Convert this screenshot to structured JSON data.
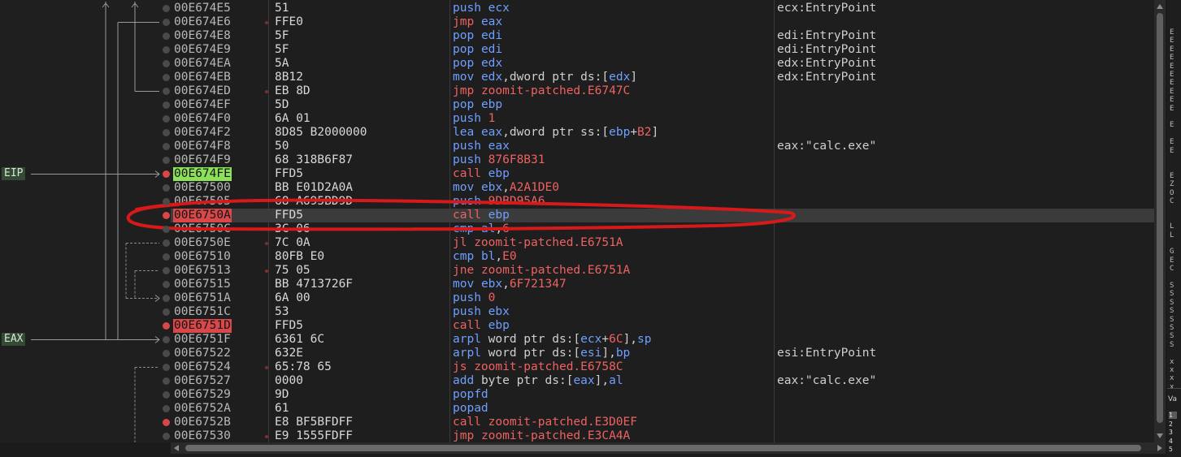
{
  "side_labels": [
    {
      "text": "EIP",
      "row": 12
    },
    {
      "text": "EAX",
      "row": 24
    }
  ],
  "rows": [
    {
      "addr": "00E674E5",
      "bytes": "51",
      "mnem": "push",
      "ops": "ecx",
      "comment": "ecx:EntryPoint",
      "marker": "grey",
      "jump": false
    },
    {
      "addr": "00E674E6",
      "bytes": "FFE0",
      "mnem": "jmp",
      "ops": "eax",
      "comment": "",
      "marker": "grey",
      "jump": true
    },
    {
      "addr": "00E674E8",
      "bytes": "5F",
      "mnem": "pop",
      "ops": "edi",
      "comment": "edi:EntryPoint",
      "marker": "grey",
      "jump": false
    },
    {
      "addr": "00E674E9",
      "bytes": "5F",
      "mnem": "pop",
      "ops": "edi",
      "comment": "edi:EntryPoint",
      "marker": "grey",
      "jump": false
    },
    {
      "addr": "00E674EA",
      "bytes": "5A",
      "mnem": "pop",
      "ops": "edx",
      "comment": "edx:EntryPoint",
      "marker": "grey",
      "jump": false
    },
    {
      "addr": "00E674EB",
      "bytes": "8B12",
      "mnem": "mov",
      "ops": "edx,dword ptr ds:[edx]",
      "comment": "edx:EntryPoint",
      "marker": "grey",
      "jump": false
    },
    {
      "addr": "00E674ED",
      "bytes": "EB 8D",
      "mnem": "jmp",
      "ops": "zoomit-patched.E6747C",
      "comment": "",
      "marker": "grey",
      "jump": true
    },
    {
      "addr": "00E674EF",
      "bytes": "5D",
      "mnem": "pop",
      "ops": "ebp",
      "comment": "",
      "marker": "grey",
      "jump": false
    },
    {
      "addr": "00E674F0",
      "bytes": "6A 01",
      "mnem": "push",
      "ops": "1",
      "comment": "",
      "marker": "grey",
      "jump": false
    },
    {
      "addr": "00E674F2",
      "bytes": "8D85 B2000000",
      "mnem": "lea",
      "ops": "eax,dword ptr ss:[ebp+B2]",
      "comment": "",
      "marker": "grey",
      "jump": false
    },
    {
      "addr": "00E674F8",
      "bytes": "50",
      "mnem": "push",
      "ops": "eax",
      "comment": "eax:\"calc.exe\"",
      "marker": "grey",
      "jump": false
    },
    {
      "addr": "00E674F9",
      "bytes": "68 318B6F87",
      "mnem": "push",
      "ops": "876F8B31",
      "comment": "",
      "marker": "grey",
      "jump": false
    },
    {
      "addr": "00E674FE",
      "bytes": "FFD5",
      "mnem": "call",
      "ops": "ebp",
      "comment": "",
      "marker": "red",
      "jump": false,
      "state": "eip"
    },
    {
      "addr": "00E67500",
      "bytes": "BB E01D2A0A",
      "mnem": "mov",
      "ops": "ebx,A2A1DE0",
      "comment": "",
      "marker": "grey",
      "jump": false
    },
    {
      "addr": "00E67505",
      "bytes": "68 A695BD9D",
      "mnem": "push",
      "ops": "9DBD95A6",
      "comment": "",
      "marker": "grey",
      "jump": false
    },
    {
      "addr": "00E6750A",
      "bytes": "FFD5",
      "mnem": "call",
      "ops": "ebp",
      "comment": "",
      "marker": "red",
      "jump": false,
      "state": "bp",
      "selected": true
    },
    {
      "addr": "00E6750C",
      "bytes": "3C 06",
      "mnem": "cmp",
      "ops": "al,6",
      "comment": "",
      "marker": "grey",
      "jump": false
    },
    {
      "addr": "00E6750E",
      "bytes": "7C 0A",
      "mnem": "jl",
      "ops": "zoomit-patched.E6751A",
      "comment": "",
      "marker": "grey",
      "jump": true
    },
    {
      "addr": "00E67510",
      "bytes": "80FB E0",
      "mnem": "cmp",
      "ops": "bl,E0",
      "comment": "",
      "marker": "grey",
      "jump": false
    },
    {
      "addr": "00E67513",
      "bytes": "75 05",
      "mnem": "jne",
      "ops": "zoomit-patched.E6751A",
      "comment": "",
      "marker": "grey",
      "jump": true
    },
    {
      "addr": "00E67515",
      "bytes": "BB 4713726F",
      "mnem": "mov",
      "ops": "ebx,6F721347",
      "comment": "",
      "marker": "grey",
      "jump": false
    },
    {
      "addr": "00E6751A",
      "bytes": "6A 00",
      "mnem": "push",
      "ops": "0",
      "comment": "",
      "marker": "grey",
      "jump": false
    },
    {
      "addr": "00E6751C",
      "bytes": "53",
      "mnem": "push",
      "ops": "ebx",
      "comment": "",
      "marker": "grey",
      "jump": false
    },
    {
      "addr": "00E6751D",
      "bytes": "FFD5",
      "mnem": "call",
      "ops": "ebp",
      "comment": "",
      "marker": "red",
      "jump": false,
      "state": "bp"
    },
    {
      "addr": "00E6751F",
      "bytes": "6361 6C",
      "mnem": "arpl",
      "ops": "word ptr ds:[ecx+6C],sp",
      "comment": "",
      "marker": "grey",
      "jump": false
    },
    {
      "addr": "00E67522",
      "bytes": "632E",
      "mnem": "arpl",
      "ops": "word ptr ds:[esi],bp",
      "comment": "esi:EntryPoint",
      "marker": "grey",
      "jump": false
    },
    {
      "addr": "00E67524",
      "bytes": "65:78 65",
      "mnem": "js",
      "ops": "zoomit-patched.E6758C",
      "comment": "",
      "marker": "grey",
      "jump": true
    },
    {
      "addr": "00E67527",
      "bytes": "0000",
      "mnem": "add",
      "ops": "byte ptr ds:[eax],al",
      "comment": "eax:\"calc.exe\"",
      "marker": "grey",
      "jump": false
    },
    {
      "addr": "00E67529",
      "bytes": "9D",
      "mnem": "popfd",
      "ops": "",
      "comment": "",
      "marker": "grey",
      "jump": false
    },
    {
      "addr": "00E6752A",
      "bytes": "61",
      "mnem": "popad",
      "ops": "",
      "comment": "",
      "marker": "grey",
      "jump": false
    },
    {
      "addr": "00E6752B",
      "bytes": "E8 BF5BFDFF",
      "mnem": "call",
      "ops": "zoomit-patched.E3D0EF",
      "comment": "",
      "marker": "red",
      "jump": false
    },
    {
      "addr": "00E67530",
      "bytes": "E9 1555FDFF",
      "mnem": "jmp",
      "ops": "zoomit-patched.E3CA4A",
      "comment": "",
      "marker": "grey",
      "jump": true
    }
  ],
  "right_pane": {
    "chars": [
      "E",
      "E",
      "E",
      "E",
      "E",
      "E",
      "E",
      "E",
      "E",
      "E",
      "",
      "E",
      "",
      "E",
      "E",
      "",
      "",
      "E",
      "Z",
      "O",
      "C",
      "",
      "",
      "L",
      "L",
      "",
      "G",
      "E",
      "C",
      "",
      "S",
      "S",
      "S",
      "S",
      "S",
      "S",
      "S",
      "S",
      "",
      "x",
      "x",
      "x",
      "x"
    ],
    "tab_label": "Va",
    "numbers": [
      "1",
      "2",
      "3",
      "4",
      "5"
    ]
  },
  "colors": {
    "eip_highlight": "#8ce05a",
    "breakpoint": "#d94848",
    "register": "#6f9fff",
    "branch": "#ee6262",
    "annotation_ring": "#d61a1a"
  }
}
